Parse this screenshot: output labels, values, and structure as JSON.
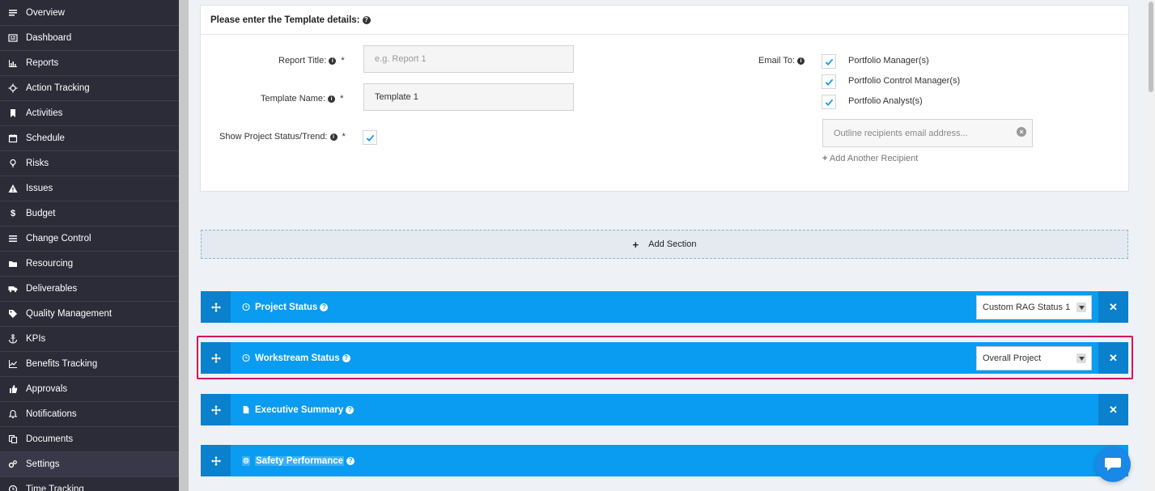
{
  "sidebar": {
    "items": [
      {
        "label": "Overview",
        "icon": "list-icon"
      },
      {
        "label": "Dashboard",
        "icon": "dashboard-icon"
      },
      {
        "label": "Reports",
        "icon": "bar-chart-icon"
      },
      {
        "label": "Action Tracking",
        "icon": "crosshair-icon"
      },
      {
        "label": "Activities",
        "icon": "bookmark-icon"
      },
      {
        "label": "Schedule",
        "icon": "calendar-icon"
      },
      {
        "label": "Risks",
        "icon": "lightbulb-icon"
      },
      {
        "label": "Issues",
        "icon": "warning-icon"
      },
      {
        "label": "Budget",
        "icon": "dollar-icon"
      },
      {
        "label": "Change Control",
        "icon": "menu-icon"
      },
      {
        "label": "Resourcing",
        "icon": "folder-icon"
      },
      {
        "label": "Deliverables",
        "icon": "truck-icon"
      },
      {
        "label": "Quality Management",
        "icon": "tag-icon"
      },
      {
        "label": "KPIs",
        "icon": "anchor-icon"
      },
      {
        "label": "Benefits Tracking",
        "icon": "line-chart-icon"
      },
      {
        "label": "Approvals",
        "icon": "thumbs-up-icon"
      },
      {
        "label": "Notifications",
        "icon": "bell-icon"
      },
      {
        "label": "Documents",
        "icon": "copy-icon"
      },
      {
        "label": "Settings",
        "icon": "gears-icon"
      },
      {
        "label": "Time Tracking",
        "icon": "clock-icon"
      }
    ],
    "active_index": 18
  },
  "template_form": {
    "header": "Please enter the Template details:",
    "report_title_label": "Report Title:",
    "report_title_placeholder": "e.g. Report 1",
    "template_name_label": "Template Name:",
    "template_name_value": "Template 1",
    "show_status_label": "Show Project Status/Trend:",
    "show_status_checked": true,
    "required_mark": "*",
    "email_to_label": "Email To:",
    "recipients": [
      {
        "label": "Portfolio Manager(s)",
        "checked": true
      },
      {
        "label": "Portfolio Control Manager(s)",
        "checked": true
      },
      {
        "label": "Portfolio Analyst(s)",
        "checked": true
      }
    ],
    "email_placeholder": "Outline recipients email address...",
    "add_recipient_label": "Add Another Recipient"
  },
  "add_section_label": "Add Section",
  "sections": [
    {
      "title": "Project Status",
      "icon": "clock-circle-icon",
      "select_value": "Custom RAG Status 1",
      "closable": true
    },
    {
      "title": "Workstream Status",
      "icon": "clock-circle-icon",
      "select_value": "Overall Project",
      "closable": true,
      "highlighted": true
    },
    {
      "title": "Executive Summary",
      "icon": "document-icon",
      "select_value": null,
      "closable": true
    },
    {
      "title": "Safety Performance",
      "icon": "life-ring-icon",
      "select_value": null,
      "closable": false
    }
  ],
  "colors": {
    "sidebar_bg": "#2c2c38",
    "section_blue": "#0a9cf0",
    "section_dark_blue": "#0b80cc",
    "highlight": "#d4145a",
    "chat_button": "#1a88e6"
  }
}
